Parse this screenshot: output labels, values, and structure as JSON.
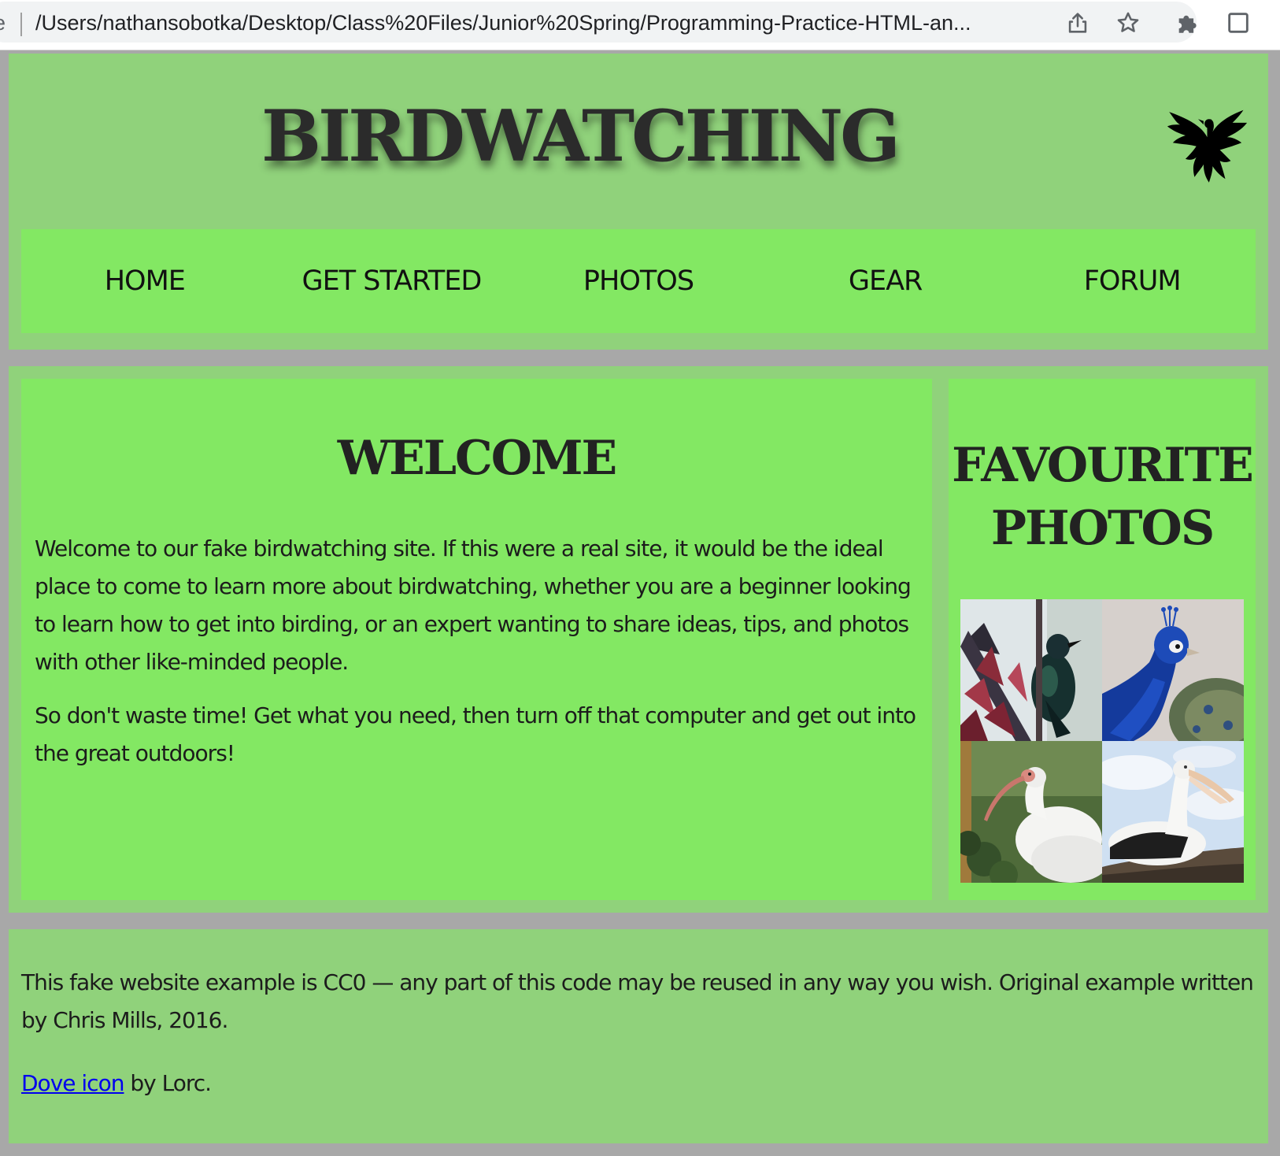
{
  "browser": {
    "url_prefix": "ile",
    "url": "/Users/nathansobotka/Desktop/Class%20Files/Junior%20Spring/Programming-Practice-HTML-an...",
    "icons": [
      "share-icon",
      "bookmark-star-icon",
      "extensions-puzzle-icon",
      "side-panel-icon"
    ]
  },
  "header": {
    "title": "BIRDWATCHING",
    "logo_icon": "dove-icon"
  },
  "nav": {
    "items": [
      {
        "label": "HOME"
      },
      {
        "label": "GET STARTED"
      },
      {
        "label": "PHOTOS"
      },
      {
        "label": "GEAR"
      },
      {
        "label": "FORUM"
      }
    ]
  },
  "main": {
    "heading": "WELCOME",
    "paragraphs": [
      "Welcome to our fake birdwatching site. If this were a real site, it would be the ideal place to come to learn more about birdwatching, whether you are a beginner looking to learn how to get into birding, or an expert wanting to share ideas, tips, and photos with other like-minded people.",
      "So don't waste time! Get what you need, then turn off that computer and get out into the great outdoors!"
    ]
  },
  "aside": {
    "heading": "FAVOURITE PHOTOS",
    "photos": [
      "tui-bird-photo",
      "peacock-photo",
      "white-ibis-photo",
      "pelican-photo"
    ]
  },
  "footer": {
    "license_text": "This fake website example is CC0 — any part of this code may be reused in any way you wish. Original example written by Chris Mills, 2016.",
    "credit_link": "Dove icon",
    "credit_rest": " by Lorc."
  },
  "colors": {
    "page_background": "#a8a8a8",
    "header_footer_green": "#90d27b",
    "panel_green": "#83e863",
    "link_blue": "#0000ee"
  }
}
